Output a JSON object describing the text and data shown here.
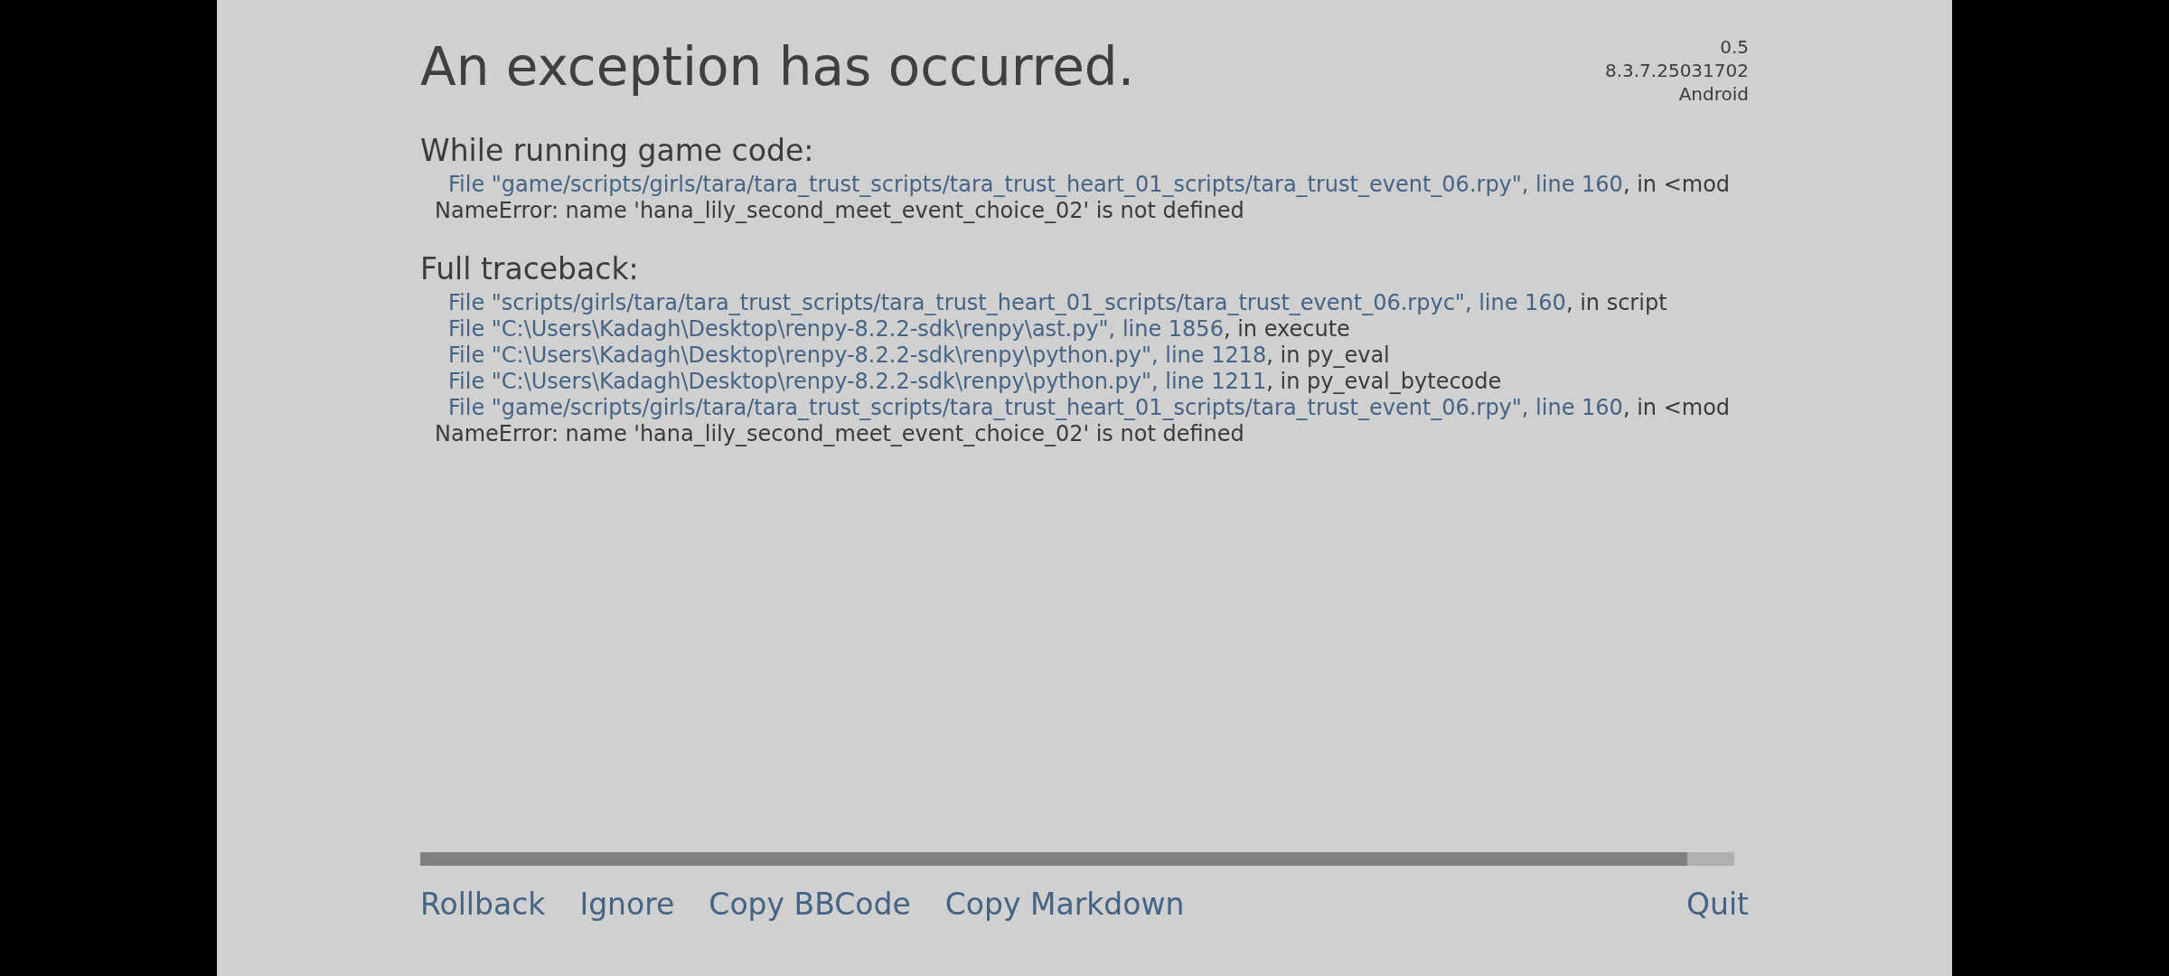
{
  "title": "An exception has occurred.",
  "version": [
    "0.5",
    "8.3.7.25031702",
    "Android"
  ],
  "sections": [
    {
      "heading": "While running game code:",
      "lines": [
        {
          "kind": "frame",
          "link": "File \"game/scripts/girls/tara/tara_trust_scripts/tara_trust_heart_01_scripts/tara_trust_event_06.rpy\", line 160",
          "text": ", in <mod"
        },
        {
          "kind": "error",
          "text": "NameError: name 'hana_lily_second_meet_event_choice_02' is not defined"
        }
      ]
    },
    {
      "heading": "Full traceback:",
      "lines": [
        {
          "kind": "frame",
          "link": "File \"scripts/girls/tara/tara_trust_scripts/tara_trust_heart_01_scripts/tara_trust_event_06.rpyc\", line 160",
          "text": ", in script"
        },
        {
          "kind": "frame",
          "link": "File \"C:\\Users\\Kadagh\\Desktop\\renpy-8.2.2-sdk\\renpy\\ast.py\", line 1856",
          "text": ", in execute"
        },
        {
          "kind": "frame",
          "link": "File \"C:\\Users\\Kadagh\\Desktop\\renpy-8.2.2-sdk\\renpy\\python.py\", line 1218",
          "text": ", in py_eval"
        },
        {
          "kind": "frame",
          "link": "File \"C:\\Users\\Kadagh\\Desktop\\renpy-8.2.2-sdk\\renpy\\python.py\", line 1211",
          "text": ", in py_eval_bytecode"
        },
        {
          "kind": "frame",
          "link": "File \"game/scripts/girls/tara/tara_trust_scripts/tara_trust_heart_01_scripts/tara_trust_event_06.rpy\", line 160",
          "text": ", in <mod"
        },
        {
          "kind": "error",
          "text": "NameError: name 'hana_lily_second_meet_event_choice_02' is not defined"
        }
      ]
    }
  ],
  "buttons_left": [
    "Rollback",
    "Ignore",
    "Copy BBCode",
    "Copy Markdown"
  ],
  "buttons_right": [
    "Quit"
  ]
}
